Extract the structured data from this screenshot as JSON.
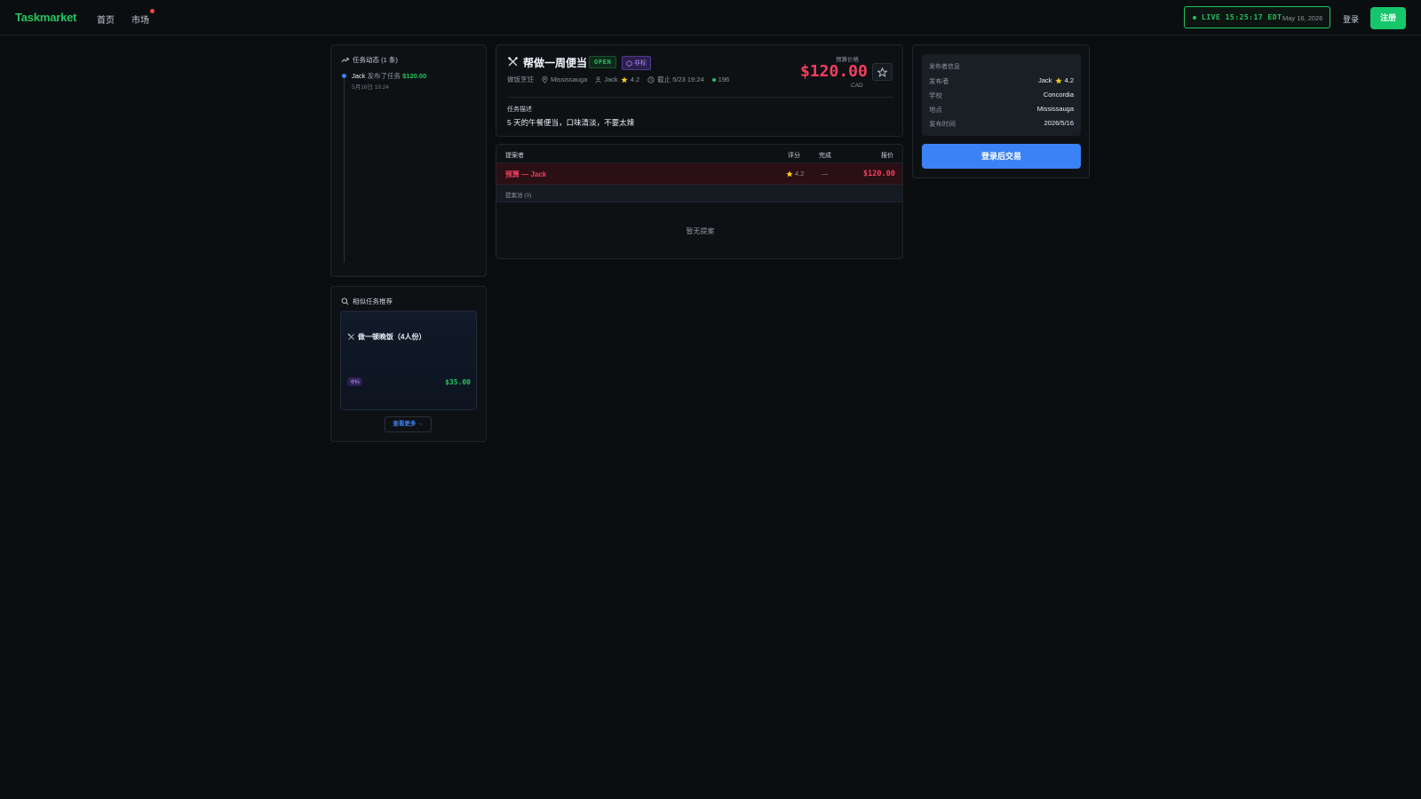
{
  "nav": {
    "brand": "Taskmarket",
    "home": "首页",
    "market": "市场",
    "live_label": "LIVE 15:25:17 EDT",
    "live_date": "May 16, 2026",
    "login": "登录",
    "register": "注册"
  },
  "activity": {
    "title": "任务动态 (1 条)",
    "entries": [
      {
        "user": "Jack",
        "verb": "发布了任务",
        "amount": "$120.00",
        "time": "5月16日 19:24"
      }
    ]
  },
  "similar": {
    "title": "相似任务推荐",
    "cards": [
      {
        "title": "做一顿晚饭（4人份）",
        "tag": "非标",
        "price": "$35.00",
        "icon": "utensils-icon"
      }
    ],
    "see_more": "查看更多 →"
  },
  "task": {
    "icon": "utensils-icon",
    "title": "帮做一周便当",
    "status": "OPEN",
    "tag": "非标",
    "category": "做饭烹饪",
    "location": "Mississauga",
    "poster": "Jack",
    "rating": "4.2",
    "deadline": "截止 5/23 19:24",
    "views": "196",
    "budget_label": "预算价格",
    "budget": "$120.00",
    "currency": "CAD",
    "desc_label": "任务描述",
    "description": "5 天的午餐便当，口味清淡，不要太辣"
  },
  "proposals": {
    "headers": {
      "proposer": "提案者",
      "rating": "评分",
      "done": "完成",
      "offer": "报价"
    },
    "budget_row": {
      "label": "预算 — Jack",
      "rating": "4.2",
      "done": "—",
      "offer": "$120.00"
    },
    "pool_label": "提案池 (0)",
    "empty": "暂无提案"
  },
  "poster_info": {
    "title": "发布者信息",
    "rows": [
      {
        "key": "发布者",
        "value": "Jack",
        "rating": "4.2"
      },
      {
        "key": "学校",
        "value": "Concordia"
      },
      {
        "key": "地点",
        "value": "Mississauga"
      },
      {
        "key": "发布时间",
        "value": "2026/5/16"
      }
    ],
    "button": "登录后交易"
  },
  "colors": {
    "accent_green": "#22c55e",
    "budget_red": "#f43f5e",
    "primary_blue": "#3b82f6",
    "tag_purple": "#a78bfa",
    "star_yellow": "#facc15"
  }
}
